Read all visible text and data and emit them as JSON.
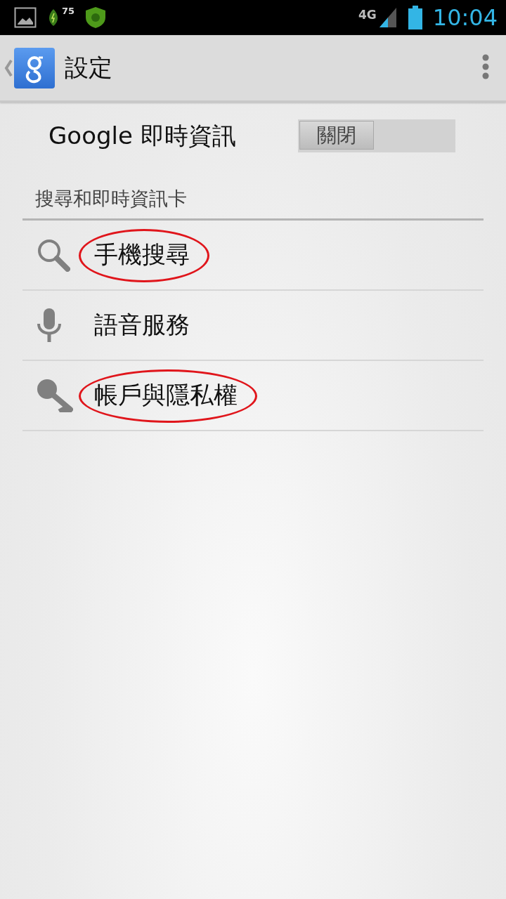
{
  "status_bar": {
    "battery_badge": "75",
    "network": "4G",
    "time": "10:04"
  },
  "action_bar": {
    "title": "設定"
  },
  "google_now": {
    "label": "Google 即時資訊",
    "toggle_label": "關閉",
    "on": false
  },
  "section": {
    "title": "搜尋和即時資訊卡"
  },
  "items": [
    {
      "kind": "search",
      "label": "手機搜尋",
      "highlighted": true
    },
    {
      "kind": "mic",
      "label": "語音服務",
      "highlighted": false
    },
    {
      "kind": "key",
      "label": "帳戶與隱私權",
      "highlighted": true
    }
  ]
}
